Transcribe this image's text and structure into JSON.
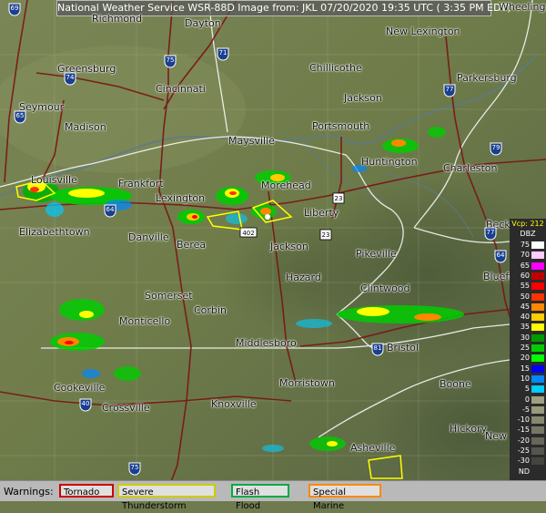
{
  "title": "National Weather Service WSR-88D Image from: JKL 07/20/2020 19:35 UTC ( 3:35 PM EDT)",
  "cities": [
    "Richmond",
    "Dayton",
    "Wheeling",
    "New Lexington",
    "Greensburg",
    "Cincinnati",
    "Chillicothe",
    "Parkersburg",
    "Seymour",
    "Jackson",
    "Madison",
    "Portsmouth",
    "Maysville",
    "Huntington",
    "Charleston",
    "Louisville",
    "Frankfort",
    "Morehead",
    "Lexington",
    "Liberty",
    "Beckley",
    "Elizabethtown",
    "Danville",
    "Berea",
    "Jackson",
    "Pikeville",
    "Bluefield",
    "Hazard",
    "Somerset",
    "Corbin",
    "Clintwood",
    "Monticello",
    "Middlesboro",
    "Bristol",
    "Cookeville",
    "Morristown",
    "Boone",
    "Crossville",
    "Knoxville",
    "Hickory",
    "Asheville",
    "New"
  ],
  "routes": [
    "69",
    "71",
    "75",
    "74",
    "65",
    "77",
    "79",
    "64",
    "23",
    "402",
    "23",
    "77",
    "64",
    "81",
    "40",
    "75"
  ],
  "legend": {
    "vcp": "Vcp: 212",
    "unit": "DBZ",
    "levels": [
      "75",
      "70",
      "65",
      "60",
      "55",
      "50",
      "45",
      "40",
      "35",
      "30",
      "25",
      "20",
      "15",
      "10",
      "5",
      "0",
      "-5",
      "-10",
      "-15",
      "-20",
      "-25",
      "-30",
      "ND"
    ],
    "colors": [
      "#ffffff",
      "#ffccff",
      "#ff00ff",
      "#c00000",
      "#ff0000",
      "#ff3300",
      "#ff8800",
      "#ffcc00",
      "#ffff00",
      "#009900",
      "#00cc00",
      "#00ff00",
      "#0000ff",
      "#0088ff",
      "#00ccff",
      "#a0a080",
      "#9a9a7c",
      "#888870",
      "#777766",
      "#66665a",
      "#555550",
      "#444440",
      "#2b2b2b"
    ]
  },
  "warnings": {
    "label": "Warnings:",
    "items": [
      {
        "label": "Tornado",
        "color": "#cc0000"
      },
      {
        "label": "Severe Thunderstorm",
        "color": "#cccc00"
      },
      {
        "label": "Flash Flood",
        "color": "#00aa44"
      },
      {
        "label": "Special Marine",
        "color": "#ff8800"
      }
    ]
  }
}
